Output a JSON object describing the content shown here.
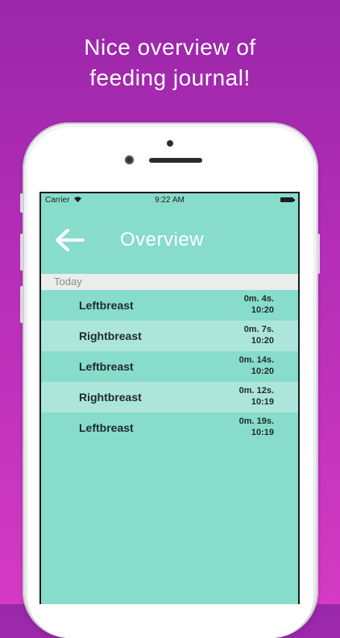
{
  "headline": {
    "line1": "Nice overview of",
    "line2": "feeding journal!"
  },
  "status_bar": {
    "carrier": "Carrier",
    "time": "9:22 AM"
  },
  "nav": {
    "title": "Overview",
    "back_icon": "back-arrow-icon"
  },
  "section": {
    "title": "Today"
  },
  "entries": [
    {
      "side": "Leftbreast",
      "duration": "0m. 4s.",
      "time": "10:20"
    },
    {
      "side": "Rightbreast",
      "duration": "0m. 7s.",
      "time": "10:20"
    },
    {
      "side": "Leftbreast",
      "duration": "0m. 14s.",
      "time": "10:20"
    },
    {
      "side": "Rightbreast",
      "duration": "0m. 12s.",
      "time": "10:19"
    },
    {
      "side": "Leftbreast",
      "duration": "0m. 19s.",
      "time": "10:19"
    }
  ],
  "colors": {
    "background_top": "#9a27aa",
    "background_bottom": "#d43ac3",
    "screen": "#87dccb",
    "row_alt": "#ace6da",
    "section_header": "#ececec"
  }
}
